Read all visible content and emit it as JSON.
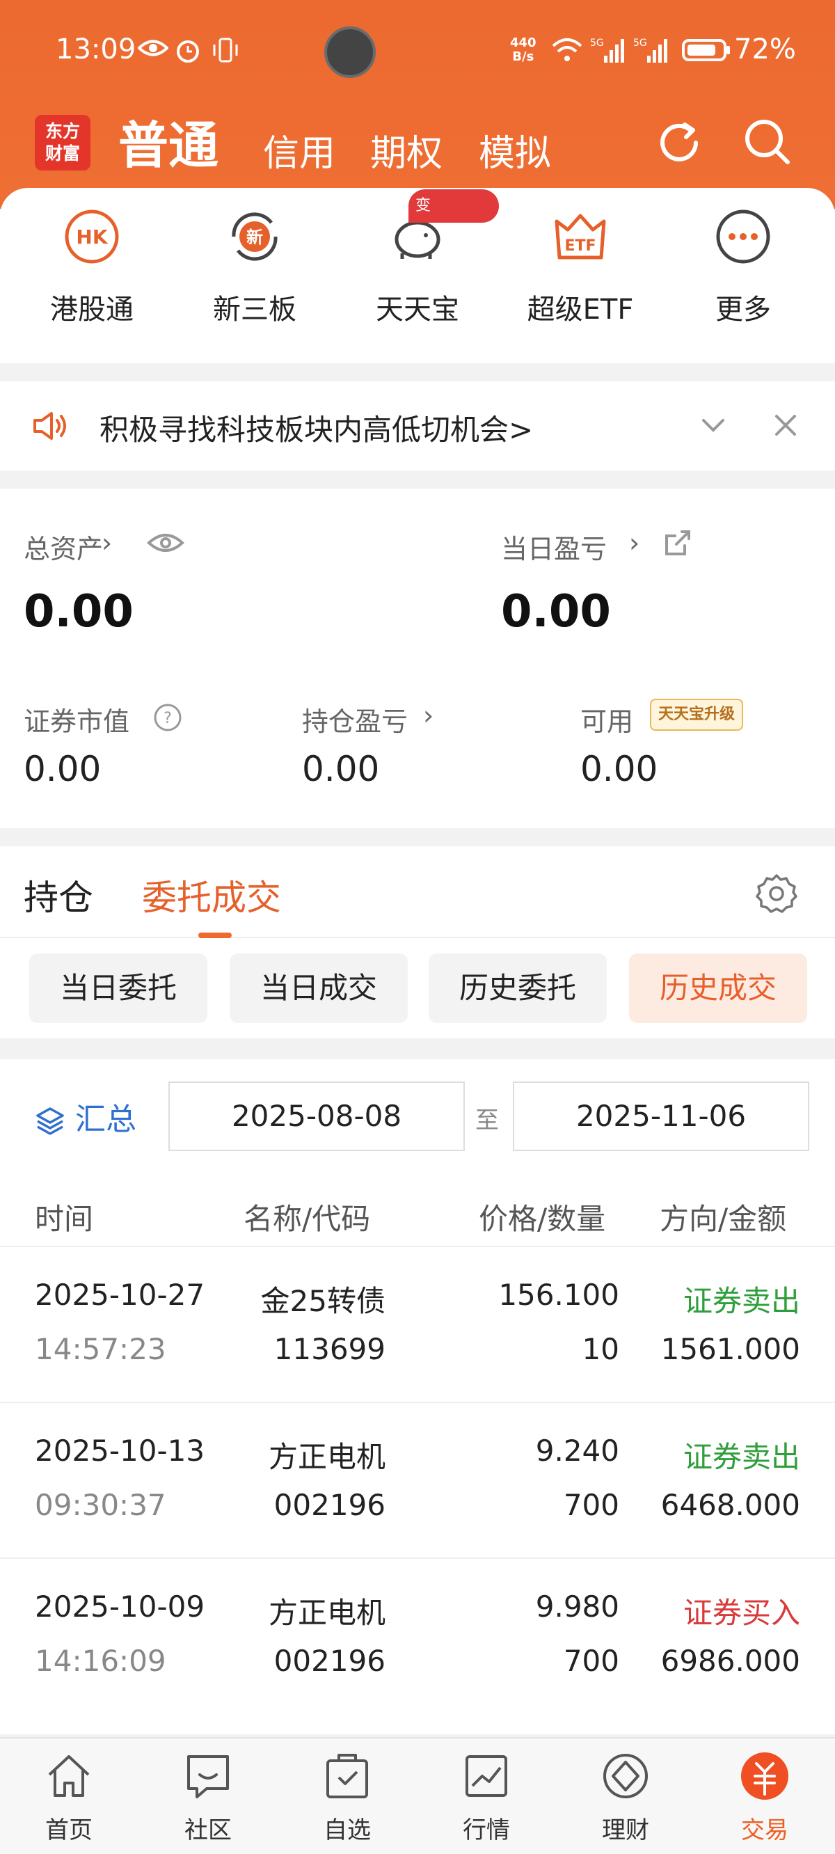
{
  "status_bar": {
    "time": "13:09",
    "net_speed_value": "440",
    "net_speed_unit": "B/s",
    "battery": "72%"
  },
  "header": {
    "logo_line1": "东方",
    "logo_line2": "财富",
    "modes": [
      "普通",
      "信用",
      "期权",
      "模拟"
    ],
    "active_mode": "普通",
    "accent_color": "#ef6a2b"
  },
  "quick_menu": [
    {
      "label": "港股通",
      "icon": "hk-icon"
    },
    {
      "label": "新三板",
      "icon": "new-board-icon"
    },
    {
      "label": "天天宝",
      "icon": "piggy-bank-icon",
      "badge": "变"
    },
    {
      "label": "超级ETF",
      "icon": "etf-crown-icon"
    },
    {
      "label": "更多",
      "icon": "more-dots-icon"
    }
  ],
  "notice": {
    "text": "积极寻找科技板块内高低切机会>"
  },
  "assets": {
    "total_label": "总资产",
    "total_value": "0.00",
    "daily_pl_label": "当日盈亏",
    "daily_pl_value": "0.00",
    "market_value_label": "证券市值",
    "market_value": "0.00",
    "position_pl_label": "持仓盈亏",
    "position_pl": "0.00",
    "available_label": "可用",
    "available": "0.00",
    "upgrade_tag": "天天宝升级"
  },
  "tabs": {
    "holdings": "持仓",
    "orders": "委托成交",
    "active": "委托成交"
  },
  "subtabs": [
    "当日委托",
    "当日成交",
    "历史委托",
    "历史成交"
  ],
  "active_subtab": "历史成交",
  "filter": {
    "summary": "汇总",
    "start_date": "2025-08-08",
    "to": "至",
    "end_date": "2025-11-06"
  },
  "table": {
    "headers": [
      "时间",
      "名称/代码",
      "价格/数量",
      "方向/金额"
    ],
    "rows": [
      {
        "date": "2025-10-27",
        "time": "14:57:23",
        "name": "金25转债",
        "code": "113699",
        "price": "156.100",
        "qty": "10",
        "direction": "证券卖出",
        "amount": "1561.000"
      },
      {
        "date": "2025-10-13",
        "time": "09:30:37",
        "name": "方正电机",
        "code": "002196",
        "price": "9.240",
        "qty": "700",
        "direction": "证券卖出",
        "amount": "6468.000"
      },
      {
        "date": "2025-10-09",
        "time": "14:16:09",
        "name": "方正电机",
        "code": "002196",
        "price": "9.980",
        "qty": "700",
        "direction": "证券买入",
        "amount": "6986.000"
      }
    ]
  },
  "bottom_nav": [
    {
      "label": "首页",
      "icon": "home-icon"
    },
    {
      "label": "社区",
      "icon": "community-icon"
    },
    {
      "label": "自选",
      "icon": "watchlist-icon"
    },
    {
      "label": "行情",
      "icon": "market-chart-icon"
    },
    {
      "label": "理财",
      "icon": "wealth-icon"
    },
    {
      "label": "交易",
      "icon": "trade-icon"
    }
  ],
  "active_nav": "交易"
}
